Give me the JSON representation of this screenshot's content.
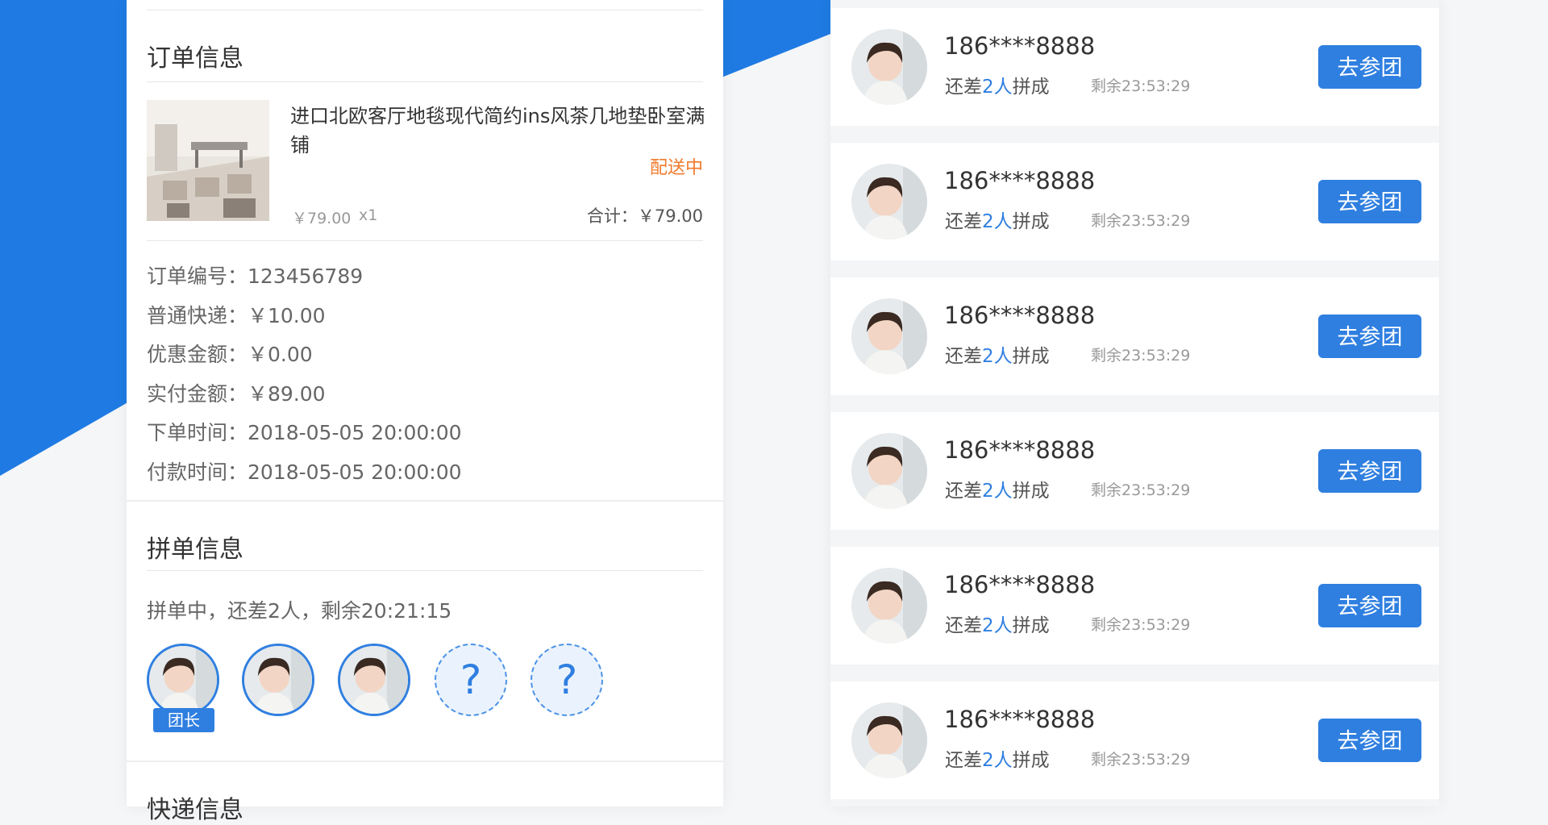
{
  "order_info": {
    "title": "订单信息",
    "product": {
      "name": "进口北欧客厅地毯现代简约ins风茶几地垫卧室满铺",
      "status": "配送中",
      "price": "￥79.00",
      "qty": "x1",
      "total": "合计：￥79.00"
    },
    "details": [
      "订单编号：123456789",
      "普通快递：￥10.00",
      "优惠金额：￥0.00",
      "实付金额：￥89.00",
      "下单时间：2018-05-05 20:00:00",
      "付款时间：2018-05-05 20:00:00"
    ]
  },
  "group_info": {
    "title": "拼单信息",
    "status": "拼单中，还差2人，剩余20:21:15",
    "leader_label": "团长",
    "unknown_symbol": "?"
  },
  "express_info": {
    "title": "快递信息"
  },
  "group_list": {
    "items": [
      {
        "phone": "186****8888",
        "need_prefix": "还差",
        "need_count": "2人",
        "need_suffix": "拼成",
        "remain": "剩余23:53:29",
        "button": "去参团"
      },
      {
        "phone": "186****8888",
        "need_prefix": "还差",
        "need_count": "2人",
        "need_suffix": "拼成",
        "remain": "剩余23:53:29",
        "button": "去参团"
      },
      {
        "phone": "186****8888",
        "need_prefix": "还差",
        "need_count": "2人",
        "need_suffix": "拼成",
        "remain": "剩余23:53:29",
        "button": "去参团"
      },
      {
        "phone": "186****8888",
        "need_prefix": "还差",
        "need_count": "2人",
        "need_suffix": "拼成",
        "remain": "剩余23:53:29",
        "button": "去参团"
      },
      {
        "phone": "186****8888",
        "need_prefix": "还差",
        "need_count": "2人",
        "need_suffix": "拼成",
        "remain": "剩余23:53:29",
        "button": "去参团"
      },
      {
        "phone": "186****8888",
        "need_prefix": "还差",
        "need_count": "2人",
        "need_suffix": "拼成",
        "remain": "剩余23:53:29",
        "button": "去参团"
      }
    ]
  },
  "colors": {
    "accent": "#2f7fe0",
    "status_orange": "#f07a2c",
    "background_blue": "#1f7be3"
  }
}
